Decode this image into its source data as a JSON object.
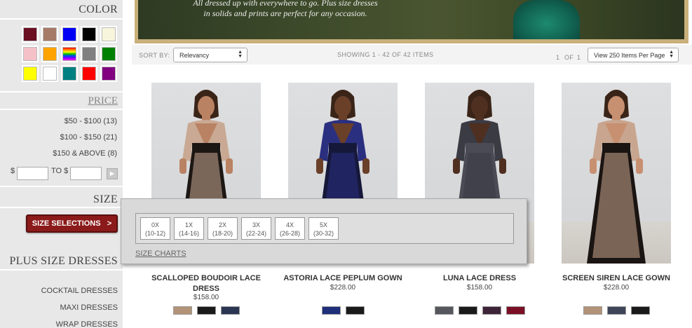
{
  "sidebar": {
    "color_title": "COLOR",
    "swatches": [
      {
        "name": "burgundy",
        "color": "#6b0f23"
      },
      {
        "name": "taupe",
        "color": "#a57a66"
      },
      {
        "name": "blue",
        "color": "#0000f5"
      },
      {
        "name": "black",
        "color": "#000000"
      },
      {
        "name": "ivory",
        "color": "#f7f5dc"
      },
      {
        "name": "pink",
        "color": "#f5c1c8"
      },
      {
        "name": "orange",
        "color": "#ffa300"
      },
      {
        "name": "multi",
        "color": "#ff00ff"
      },
      {
        "name": "grey",
        "color": "#808080"
      },
      {
        "name": "green",
        "color": "#008000"
      },
      {
        "name": "yellow",
        "color": "#ffff00"
      },
      {
        "name": "white",
        "color": "#ffffff"
      },
      {
        "name": "teal",
        "color": "#008080"
      },
      {
        "name": "red",
        "color": "#ff0000"
      },
      {
        "name": "purple",
        "color": "#800080"
      }
    ],
    "price_title": "PRICE",
    "price_ranges": [
      "$50 - $100 (13)",
      "$100 - $150 (21)",
      "$150 & ABOVE (8)"
    ],
    "range_prefix": "$",
    "range_to": "TO $",
    "range_go_icon": "▶",
    "size_title": "SIZE",
    "size_button": "SIZE SELECTIONS",
    "size_button_icon": ">",
    "category_title": "PLUS SIZE DRESSES",
    "categories": [
      "COCKTAIL DRESSES",
      "MAXI DRESSES",
      "WRAP DRESSES"
    ]
  },
  "hero": {
    "line1": "All dressed up with everywhere to go. Plus size dresses",
    "line2": "in solids and prints are perfect for any occasion."
  },
  "toolbar": {
    "sort_label": "SORT BY:",
    "sort_value": "Relevancy",
    "showing": "SHOWING 1 - 42 OF 42 ITEMS",
    "page_current": "1",
    "page_of": "OF",
    "page_total": "1",
    "per_page": "View 250 Items Per Page"
  },
  "products": [
    {
      "name": "SCALLOPED BOUDOIR LACE DRESS",
      "price": "$158.00",
      "skin": "#b98262",
      "dress": "#1d1714",
      "lace": "#c9a993",
      "colors": [
        "#b39377",
        "#1a1a1a",
        "#2a3552"
      ]
    },
    {
      "name": "ASTORIA LACE PEPLUM GOWN",
      "price": "$228.00",
      "skin": "#6a4029",
      "dress": "#16183a",
      "lace": "#2a2f80",
      "colors": [
        "#1f2f7a",
        "#1a1a1a"
      ]
    },
    {
      "name": "LUNA LACE DRESS",
      "price": "$158.00",
      "skin": "#4f2f20",
      "dress": "#4a4b55",
      "lace": "#3a3b43",
      "colors": [
        "#55575d",
        "#1a1a1a",
        "#3d2438",
        "#7a0f25"
      ]
    },
    {
      "name": "SCREEN SIREN LACE GOWN",
      "price": "$228.00",
      "skin": "#c79071",
      "dress": "#1a1412",
      "lace": "#c8a58e",
      "colors": [
        "#b39377",
        "#3f4558",
        "#1a1a1a"
      ]
    }
  ],
  "size_popup": {
    "sizes": [
      {
        "label": "0X",
        "range": "(10-12)"
      },
      {
        "label": "1X",
        "range": "(14-16)"
      },
      {
        "label": "2X",
        "range": "(18-20)"
      },
      {
        "label": "3X",
        "range": "(22-24)"
      },
      {
        "label": "4X",
        "range": "(26-28)"
      },
      {
        "label": "5X",
        "range": "(30-32)"
      }
    ],
    "size_charts": "SIZE CHARTS"
  }
}
